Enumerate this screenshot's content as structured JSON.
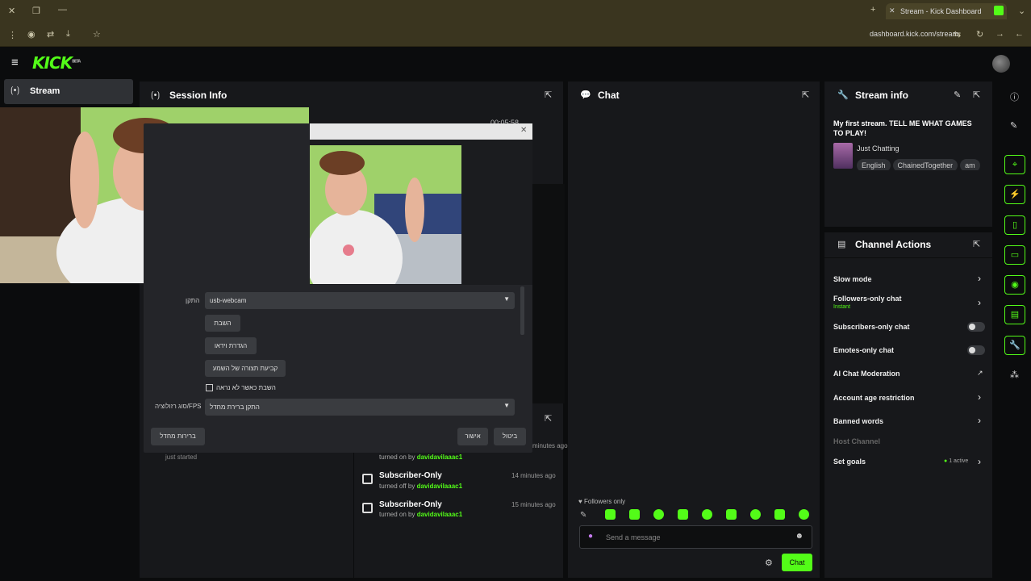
{
  "browser": {
    "tab_title": "Stream - Kick Dashboard",
    "url": "dashboard.kick.com/stream"
  },
  "app": {
    "logo": "KICK",
    "logo_sup": "BETA"
  },
  "sidenav": {
    "stream_label": "Stream"
  },
  "session_info": {
    "title": "Session Info",
    "timer": "00:05:58",
    "just_started": "just started"
  },
  "dialog": {
    "device_label": "התקן",
    "device_value": "usb-webcam",
    "btn_disable": "השבת",
    "btn_video_settings": "הגדרת וידאו",
    "btn_config_audio": "קביעת תצורה של השמע",
    "checkbox_label": "השבת כאשר לא נראה",
    "fps_label": "סוג רזולוציה/FPS",
    "fps_value": "התקן ברירת מחדל",
    "btn_defaults": "ברירות מחדל",
    "btn_ok": "אישור",
    "btn_cancel": "ביטול"
  },
  "events": [
    {
      "title": "",
      "action": "turned on by",
      "user": "davidavilaaac1",
      "time": "minutes ago"
    },
    {
      "title": "Subscriber-Only",
      "action": "turned off by",
      "user": "davidavilaaac1",
      "time": "14 minutes ago"
    },
    {
      "title": "Subscriber-Only",
      "action": "turned on by",
      "user": "davidavilaaac1",
      "time": "15 minutes ago"
    }
  ],
  "chat": {
    "title": "Chat",
    "followers_only": "Followers only",
    "placeholder": "Send a message",
    "send_label": "Chat"
  },
  "stream_info": {
    "title": "Stream info",
    "stream_title": "My first stream. TELL ME WHAT GAMES TO PLAY!",
    "category": "Just Chatting",
    "tags": [
      "English",
      "ChainedTogether",
      "am"
    ]
  },
  "channel_actions": {
    "title": "Channel Actions",
    "slow_mode": "Slow mode",
    "followers_only_chat": "Followers-only chat",
    "followers_only_sub": "Instant",
    "subscribers_only_chat": "Subscribers-only chat",
    "emotes_only_chat": "Emotes-only chat",
    "ai_moderation": "AI Chat Moderation",
    "account_age": "Account age restriction",
    "banned_words": "Banned words",
    "host_channel": "Host Channel",
    "set_goals": "Set goals",
    "set_goals_status": "1 active"
  },
  "colors": {
    "accent": "#53fc18",
    "panel": "#17181b",
    "background": "#0b0c0d"
  },
  "icons": [
    "menu-icon",
    "broadcast-icon",
    "popout-icon",
    "chat-icon",
    "wrench-icon",
    "pencil-icon",
    "info-icon",
    "gift-icon",
    "settings-icon",
    "smile-icon",
    "mic-icon"
  ]
}
